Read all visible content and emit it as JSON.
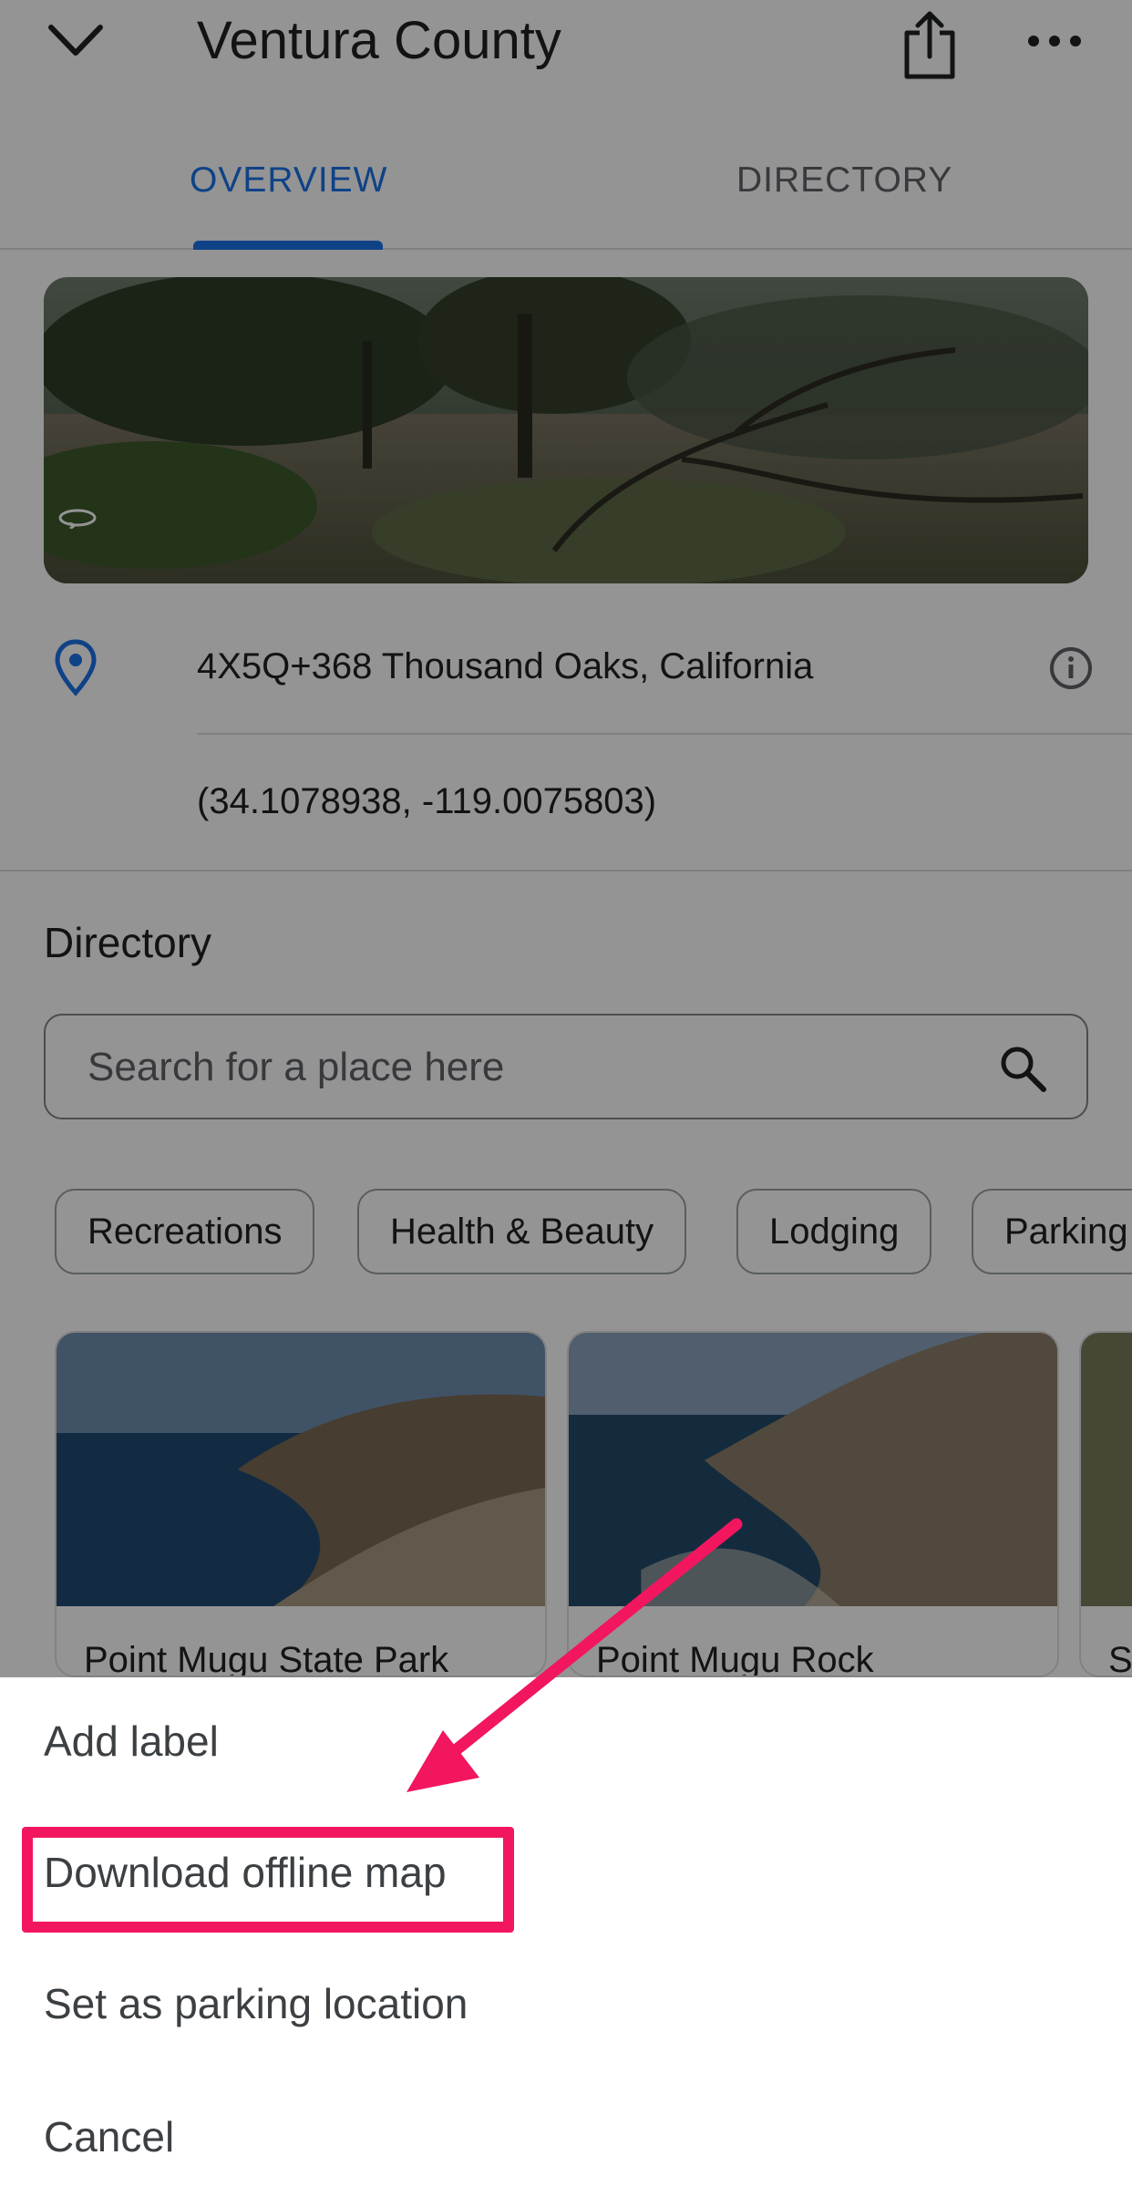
{
  "header": {
    "title": "Ventura County",
    "back_icon": "chevron-down-icon",
    "share_icon": "share-icon",
    "more_icon": "more-horizontal-icon"
  },
  "tabs": [
    {
      "label": "OVERVIEW",
      "selected": true
    },
    {
      "label": "DIRECTORY",
      "selected": false
    }
  ],
  "overview": {
    "address": "4X5Q+368 Thousand Oaks, California",
    "coordinates": "(34.1078938, -119.0075803)"
  },
  "directory": {
    "title": "Directory",
    "search_placeholder": "Search for a place here",
    "chips": [
      "Recreations",
      "Health & Beauty",
      "Lodging",
      "Parking"
    ],
    "cards": [
      {
        "title": "Point Mugu State Park"
      },
      {
        "title": "Point Mugu Rock"
      },
      {
        "title": "S"
      }
    ]
  },
  "action_sheet": {
    "items": [
      "Add label",
      "Download offline map",
      "Set as parking location",
      "Cancel"
    ],
    "highlighted_item": "Download offline map"
  },
  "colors": {
    "accent": "#1a73e8",
    "highlight": "#f2165f"
  }
}
